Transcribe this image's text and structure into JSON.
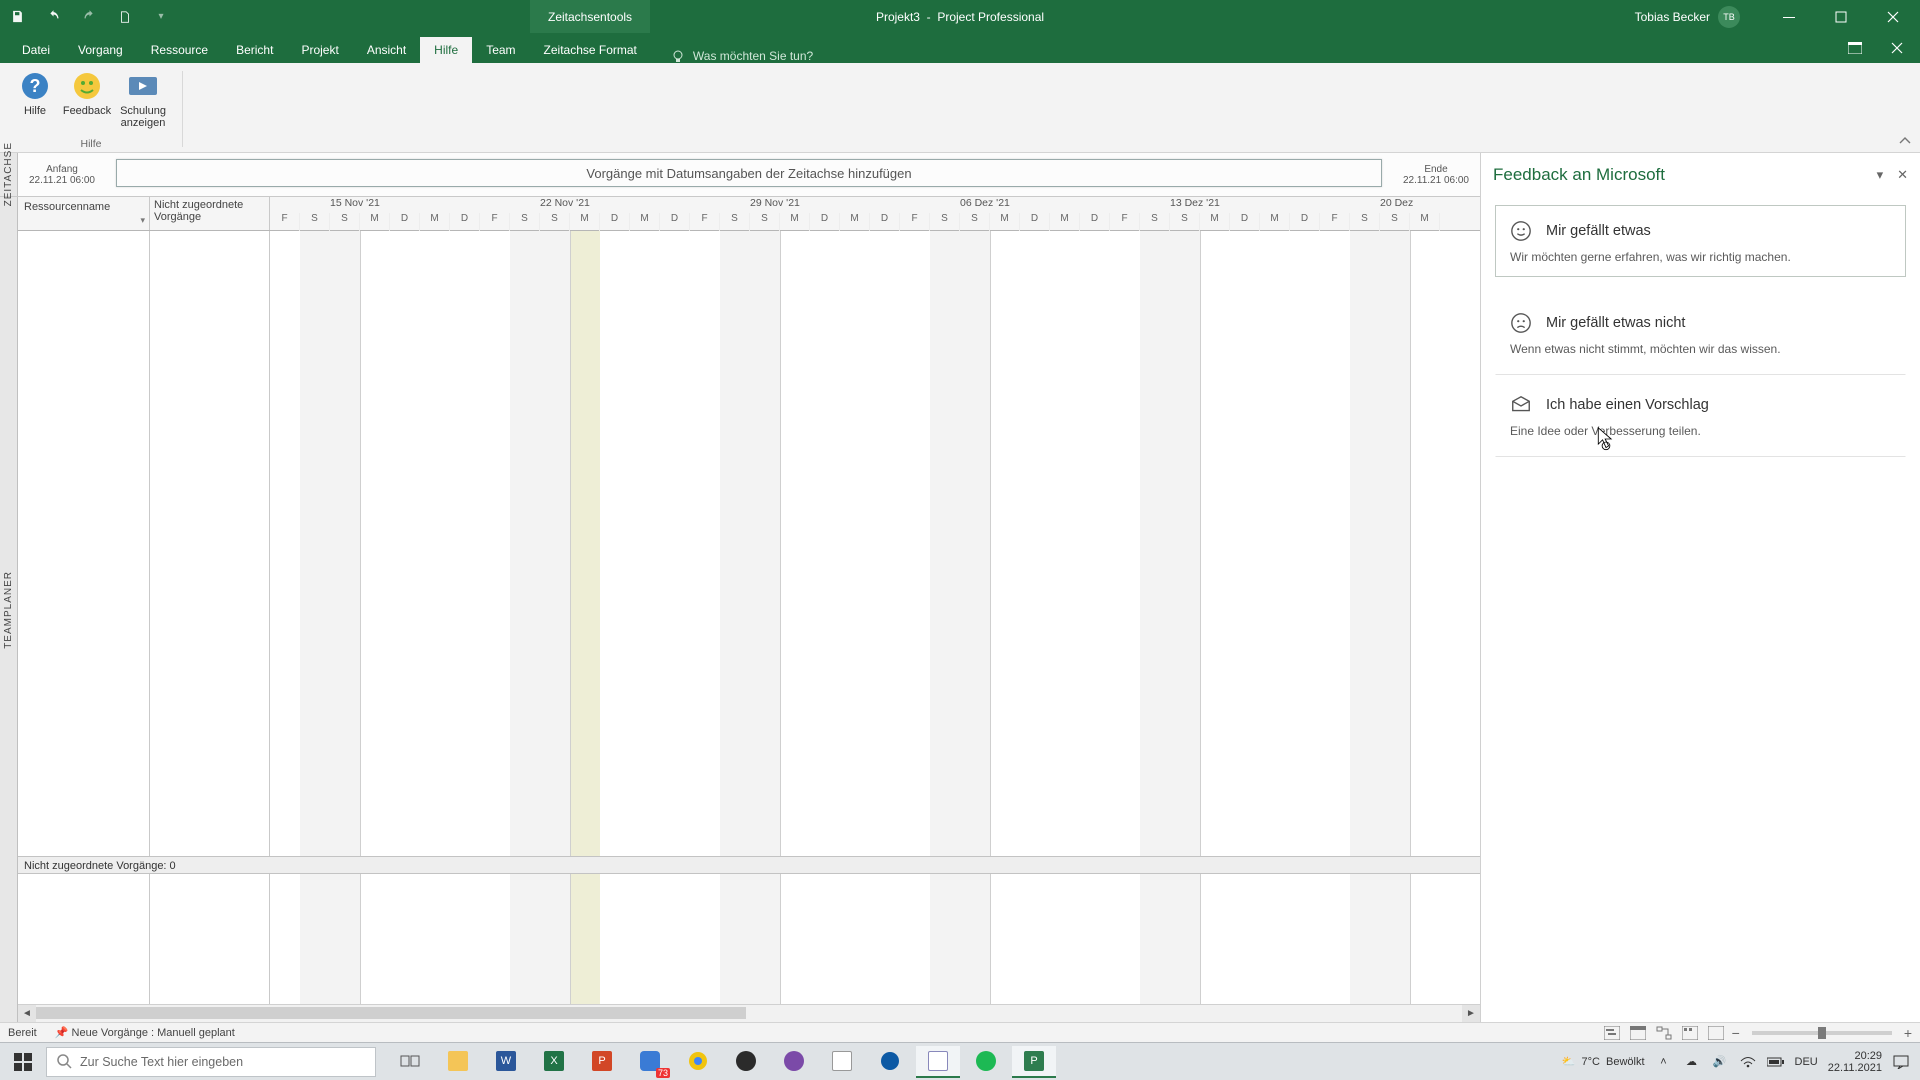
{
  "titlebar": {
    "tools": "Zeitachsentools",
    "doc": "Projekt3",
    "app": "Project Professional",
    "user_name": "Tobias Becker",
    "user_initials": "TB"
  },
  "tabs": {
    "file": "Datei",
    "vorgang": "Vorgang",
    "ressource": "Ressource",
    "bericht": "Bericht",
    "projekt": "Projekt",
    "ansicht": "Ansicht",
    "hilfe": "Hilfe",
    "team": "Team",
    "format": "Zeitachse Format",
    "tellme": "Was möchten Sie tun?"
  },
  "ribbon": {
    "hilfe": "Hilfe",
    "feedback": "Feedback",
    "schulung": "Schulung\nanzeigen",
    "group": "Hilfe"
  },
  "timeline": {
    "vert": "ZEITACHSE",
    "start_label": "Anfang",
    "start_date": "22.11.21 06:00",
    "end_label": "Ende",
    "end_date": "22.11.21 06:00",
    "box_text": "Vorgänge mit Datumsangaben der Zeitachse hinzufügen"
  },
  "planner": {
    "vert": "TEAMPLANER",
    "col1": "Ressourcenname",
    "col2": "Nicht zugeordnete\nVorgänge",
    "weeks": [
      "15 Nov '21",
      "22 Nov '21",
      "29 Nov '21",
      "06 Dez '21",
      "13 Dez '21",
      "20 Dez"
    ],
    "days": [
      "F",
      "S",
      "S",
      "M",
      "D",
      "M",
      "D",
      "F",
      "S",
      "S",
      "M",
      "D",
      "M",
      "D",
      "F",
      "S",
      "S",
      "M",
      "D",
      "M",
      "D",
      "F",
      "S",
      "S",
      "M",
      "D",
      "M",
      "D",
      "F",
      "S",
      "S",
      "M",
      "D",
      "M",
      "D",
      "F",
      "S",
      "S",
      "M"
    ],
    "unassigned": "Nicht zugeordnete Vorgänge: 0"
  },
  "feedback": {
    "title": "Feedback an Microsoft",
    "like_title": "Mir gefällt etwas",
    "like_desc": "Wir möchten gerne erfahren, was wir richtig machen.",
    "dislike_title": "Mir gefällt etwas nicht",
    "dislike_desc": "Wenn etwas nicht stimmt, möchten wir das wissen.",
    "suggest_title": "Ich habe einen Vorschlag",
    "suggest_desc": "Eine Idee oder Verbesserung teilen."
  },
  "status": {
    "ready": "Bereit",
    "new_tasks": "Neue Vorgänge : Manuell geplant"
  },
  "taskbar": {
    "search_placeholder": "Zur Suche Text hier eingeben",
    "weather_temp": "7°C",
    "weather_cond": "Bewölkt",
    "lang": "DEU",
    "time": "20:29",
    "date": "22.11.2021",
    "chrome_badge": "73"
  }
}
